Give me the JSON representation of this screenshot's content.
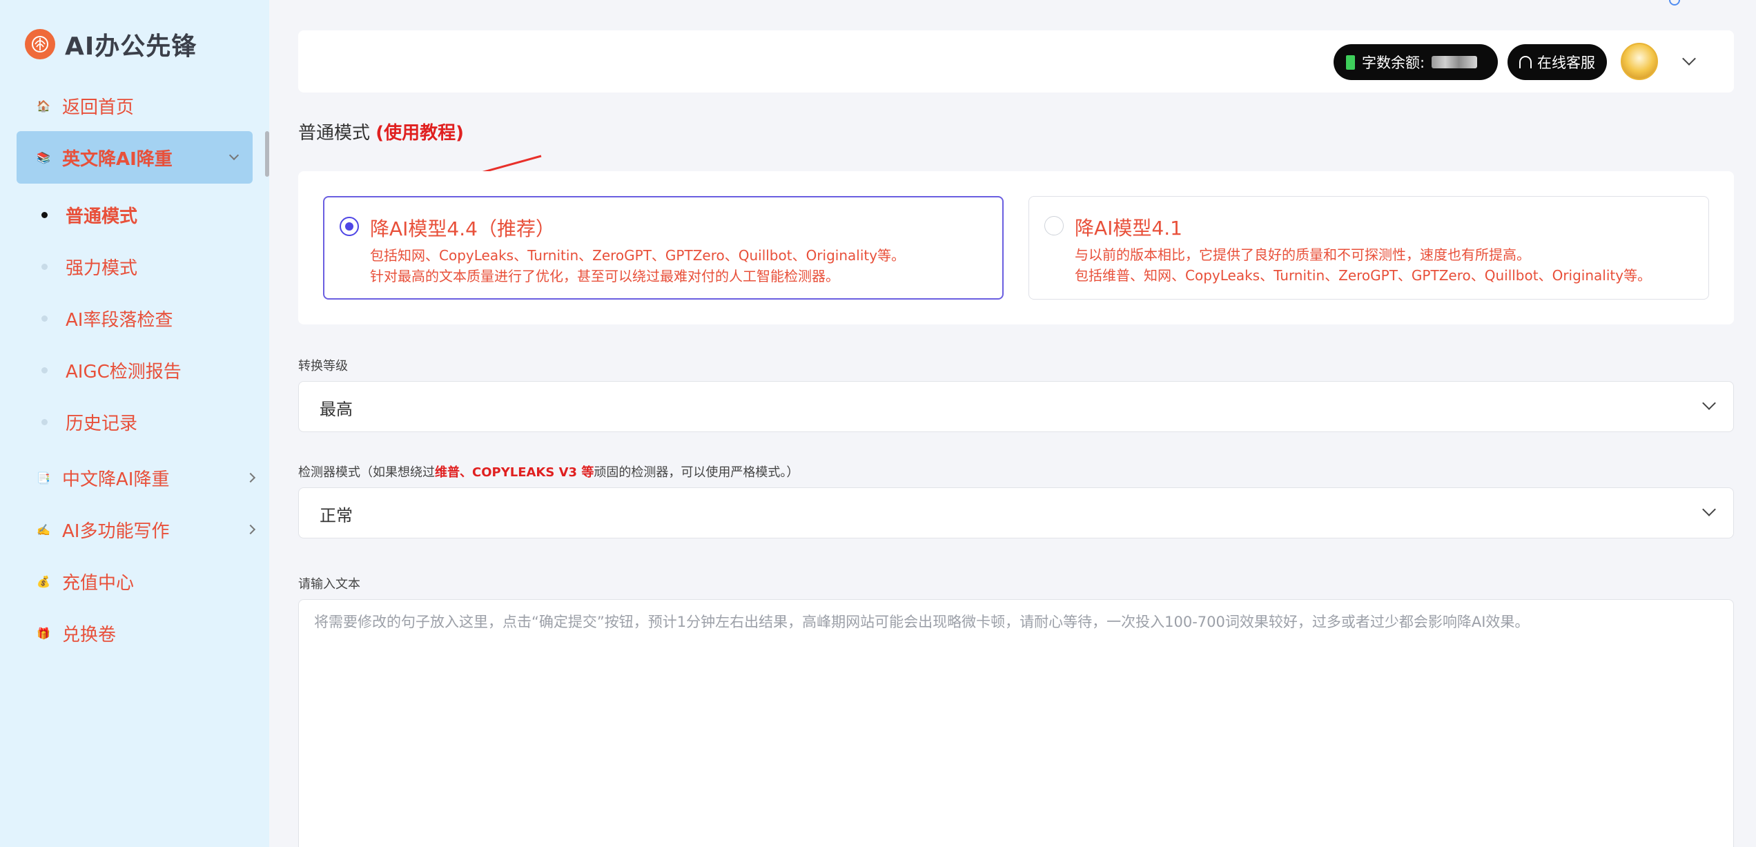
{
  "app": {
    "logo_text": "AI办公先锋"
  },
  "sidebar": {
    "home": {
      "emoji": "🏠",
      "label": "返回首页"
    },
    "english": {
      "emoji": "📚",
      "label": "英文降AI降重"
    },
    "sub_items": [
      {
        "label": "普通模式"
      },
      {
        "label": "强力模式"
      },
      {
        "label": "AI率段落检查"
      },
      {
        "label": "AIGC检测报告"
      },
      {
        "label": "历史记录"
      }
    ],
    "chinese": {
      "emoji": "📑",
      "label": "中文降AI降重"
    },
    "writing": {
      "emoji": "✍️",
      "label": "AI多功能写作"
    },
    "recharge": {
      "emoji": "💰",
      "label": "充值中心"
    },
    "coupon": {
      "emoji": "🎁",
      "label": "兑换卷"
    }
  },
  "header": {
    "balance_label": "字数余额:",
    "service_label": "在线客服"
  },
  "page": {
    "title": "普通模式",
    "tutorial": "(使用教程)"
  },
  "models": [
    {
      "title": "降AI模型4.4（推荐）",
      "line1": "包括知网、CopyLeaks、Turnitin、ZeroGPT、GPTZero、Quillbot、Originality等。",
      "line2": "针对最高的文本质量进行了优化，甚至可以绕过最难对付的人工智能检测器。",
      "selected": true
    },
    {
      "title": "降AI模型4.1",
      "line1": "与以前的版本相比，它提供了良好的质量和不可探测性，速度也有所提高。",
      "line2": "包括维普、知网、CopyLeaks、Turnitin、ZeroGPT、GPTZero、Quillbot、Originality等。",
      "selected": false
    }
  ],
  "conversion": {
    "label": "转换等级",
    "value": "最高"
  },
  "detector": {
    "label_prefix": "检测器模式（如果想绕过",
    "label_highlight": "维普、COPYLEAKS V3 等",
    "label_suffix": "顽固的检测器，可以使用严格模式。）",
    "value": "正常"
  },
  "input": {
    "label": "请输入文本",
    "placeholder": "将需要修改的句子放入这里，点击“确定提交”按钮，预计1分钟左右出结果，高峰期网站可能会出现略微卡顿，请耐心等待，一次投入100-700词效果较好，过多或者过少都会影响降AI效果。"
  },
  "colors": {
    "accent_red": "#e8503a",
    "radio_blue": "#4f46e5",
    "sidebar_bg": "#e2f3fd",
    "active_bg": "#a4d2f2"
  }
}
